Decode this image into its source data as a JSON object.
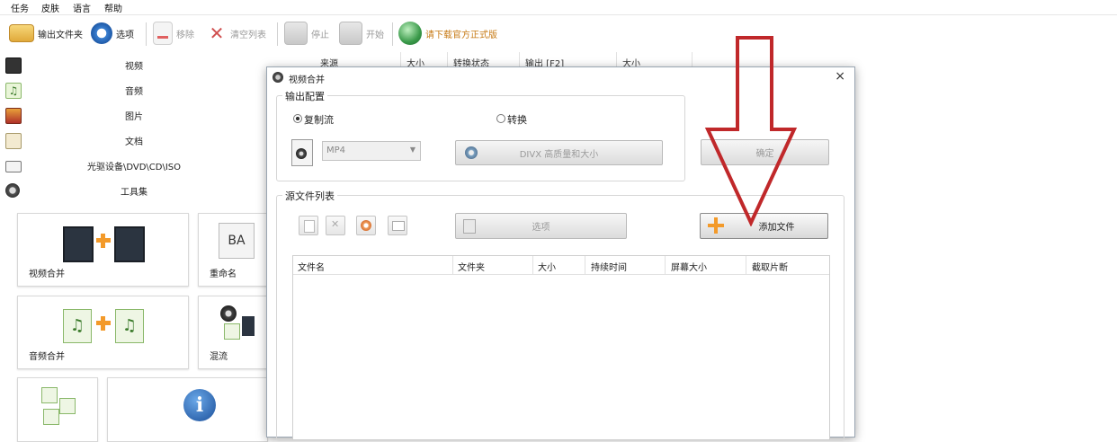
{
  "menubar": {
    "items": [
      "任务",
      "皮肤",
      "语言",
      "帮助"
    ]
  },
  "toolbar": {
    "output_folder": "输出文件夹",
    "options": "选项",
    "remove": "移除",
    "clear_list": "清空列表",
    "stop": "停止",
    "start": "开始",
    "download_official": "请下载官方正式版"
  },
  "categories": [
    {
      "label": "视频",
      "icon": "film-icon"
    },
    {
      "label": "音频",
      "icon": "music-icon"
    },
    {
      "label": "图片",
      "icon": "picture-icon"
    },
    {
      "label": "文档",
      "icon": "document-icon"
    },
    {
      "label": "光驱设备\\DVD\\CD\\ISO",
      "icon": "disc-drive-icon"
    },
    {
      "label": "工具集",
      "icon": "tools-icon"
    }
  ],
  "tools": [
    {
      "label": "视频合并"
    },
    {
      "label": "重命名"
    },
    {
      "label": "音频合并"
    },
    {
      "label": "混流"
    }
  ],
  "main_columns": [
    "来源",
    "大小",
    "转换状态",
    "输出 [F2]",
    "大小"
  ],
  "dialog": {
    "title": "视频合并",
    "close": "×",
    "output_config": "输出配置",
    "copy_stream": "复制流",
    "convert": "转换",
    "format_value": "MP4",
    "quality_button": "DIVX 高质量和大小",
    "ok_button": "确定",
    "source_list": "源文件列表",
    "options_button": "选项",
    "add_file_button": "添加文件",
    "columns": [
      "文件名",
      "文件夹",
      "大小",
      "持续时间",
      "屏幕大小",
      "截取片断"
    ]
  },
  "colors": {
    "arrow": "#c0282a",
    "orange": "#f39a2a",
    "accent_green": "#3a9a4a"
  }
}
